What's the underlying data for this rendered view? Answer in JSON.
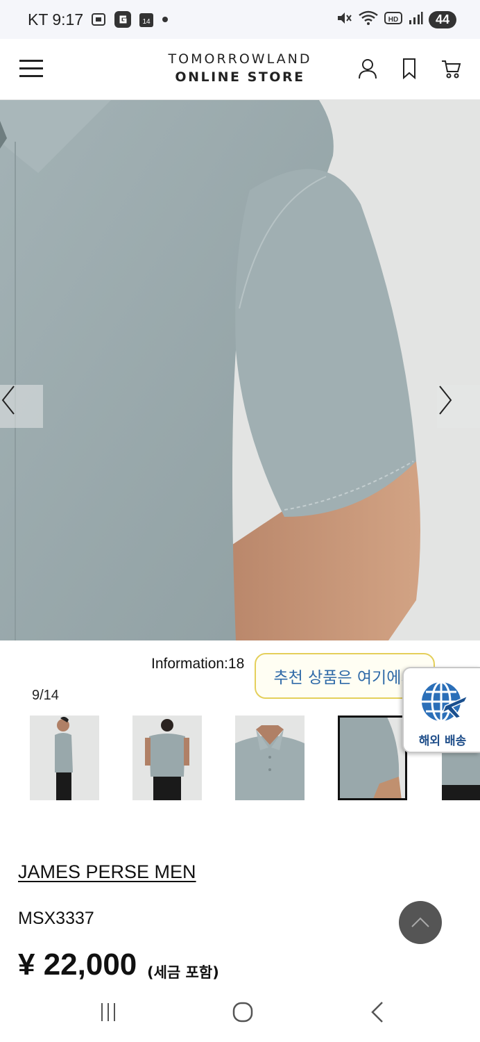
{
  "status_bar": {
    "carrier_time": "KT 9:17",
    "calendar_day": "14",
    "battery": "44"
  },
  "header": {
    "logo_line1": "TOMORROWLAND",
    "logo_line2": "ONLINE STORE",
    "icons": [
      "menu-icon",
      "account-icon",
      "bookmark-icon",
      "cart-icon"
    ]
  },
  "gallery": {
    "info_text": "Information:18",
    "counter": "9/14",
    "current_index": 9,
    "total": 14,
    "thumb_count_visible": 5,
    "active_thumb": 4
  },
  "popups": {
    "recommend_text": "추천 상품은 여기에서",
    "overseas_label": "해외 배송"
  },
  "product": {
    "brand": "JAMES PERSE MEN",
    "sku": "MSX3337",
    "price": "¥ 22,000",
    "price_note": "(세금 포함)"
  },
  "colors": {
    "shirt": "#98a8ab",
    "background": "#e4e5e4",
    "bubble_text": "#2f6aa8",
    "bubble_border": "#e4cf5a",
    "overseas_text": "#1f4e8a"
  }
}
